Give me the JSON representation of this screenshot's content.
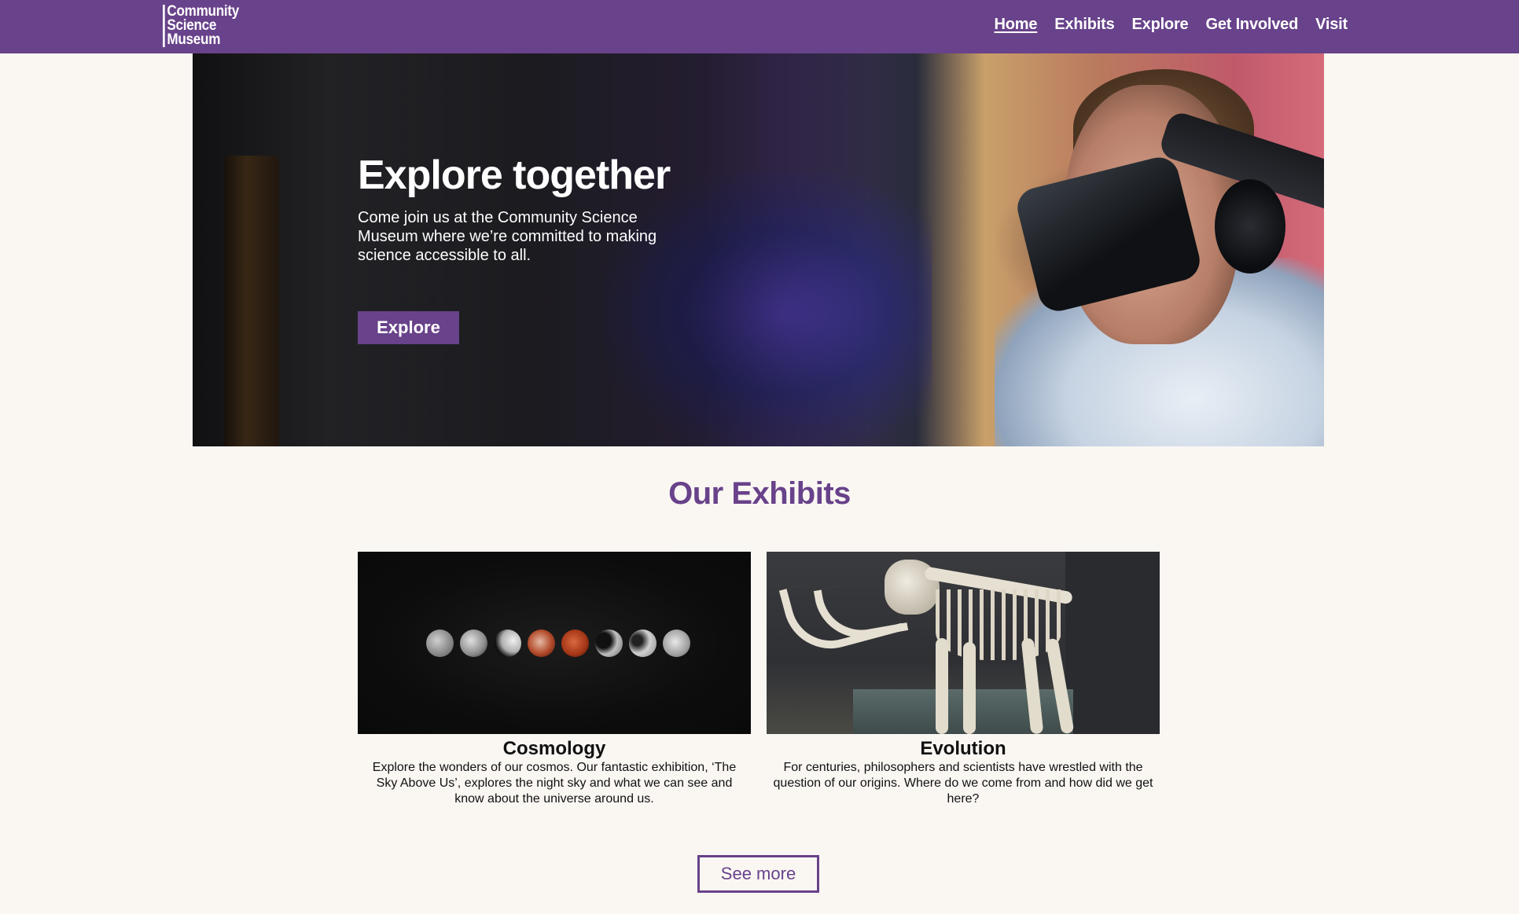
{
  "header": {
    "logo_lines": [
      "Community",
      "Science",
      "Museum"
    ],
    "nav": [
      {
        "label": "Home",
        "active": true
      },
      {
        "label": "Exhibits"
      },
      {
        "label": "Explore"
      },
      {
        "label": "Get Involved"
      },
      {
        "label": "Visit"
      }
    ],
    "brand_color": "#68428a"
  },
  "hero": {
    "title": "Explore together",
    "subtitle": "Come join us at the Community Science Museum where we’re committed to making science accessible to all.",
    "button_label": "Explore"
  },
  "exhibits": {
    "title": "Our Exhibits",
    "cards": [
      {
        "title": "Cosmology",
        "description": "Explore the wonders of our cosmos. Our fantastic exhibition, ‘The Sky Above Us’, explores the night sky and what we can see and know about the universe around us."
      },
      {
        "title": "Evolution",
        "description": "For centuries, philosophers and scientists have wrestled with the question of our origins. Where do we come from and how did we get here?"
      }
    ],
    "see_more_label": "See more"
  }
}
